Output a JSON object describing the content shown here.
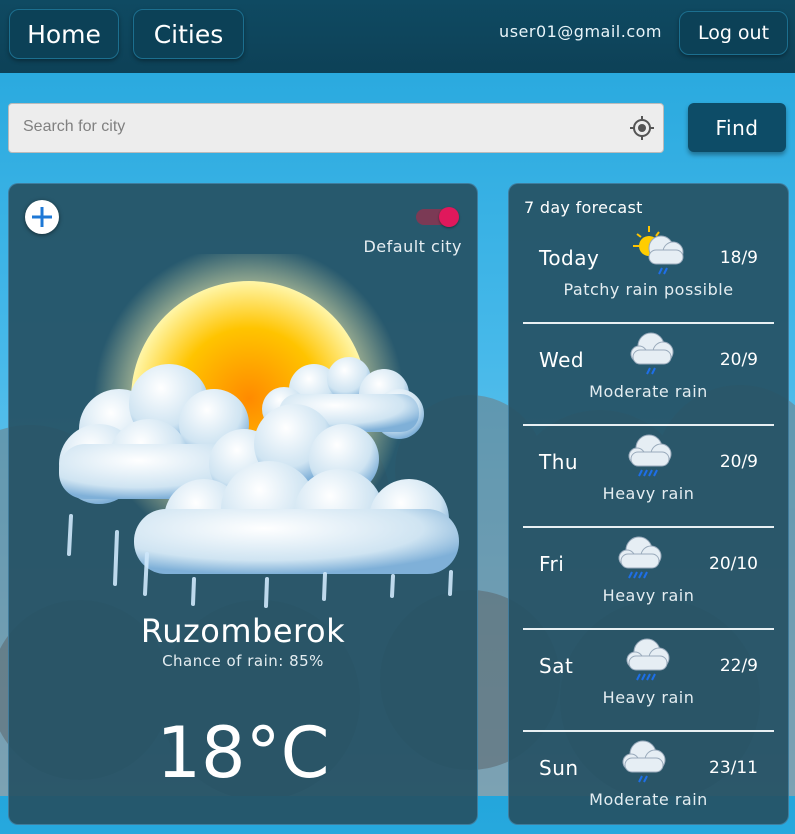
{
  "nav": {
    "home_label": "Home",
    "cities_label": "Cities",
    "user_email": "user01@gmail.com",
    "logout_label": "Log out"
  },
  "search": {
    "placeholder": "Search for city",
    "value": "",
    "find_label": "Find"
  },
  "current": {
    "default_city_label": "Default city",
    "default_city_enabled": true,
    "city": "Ruzomberok",
    "chance_of_rain": "Chance of rain: 85%",
    "temperature": "18°C",
    "icon": "sun-behind-rain-clouds-icon"
  },
  "forecast": {
    "title": "7 day forecast",
    "days": [
      {
        "day": "Today",
        "temp": "18/9",
        "condition": "Patchy rain possible",
        "icon": "patchy-rain-icon"
      },
      {
        "day": "Wed",
        "temp": "20/9",
        "condition": "Moderate rain",
        "icon": "moderate-rain-icon"
      },
      {
        "day": "Thu",
        "temp": "20/9",
        "condition": "Heavy rain",
        "icon": "heavy-rain-icon"
      },
      {
        "day": "Fri",
        "temp": "20/10",
        "condition": "Heavy rain",
        "icon": "heavy-rain-icon"
      },
      {
        "day": "Sat",
        "temp": "22/9",
        "condition": "Heavy rain",
        "icon": "heavy-rain-icon"
      },
      {
        "day": "Sun",
        "temp": "23/11",
        "condition": "Moderate rain",
        "icon": "moderate-rain-icon"
      }
    ]
  },
  "colors": {
    "accent": "#0d4c67",
    "toggle_on": "#e0185c",
    "card_bg": "#265264"
  }
}
